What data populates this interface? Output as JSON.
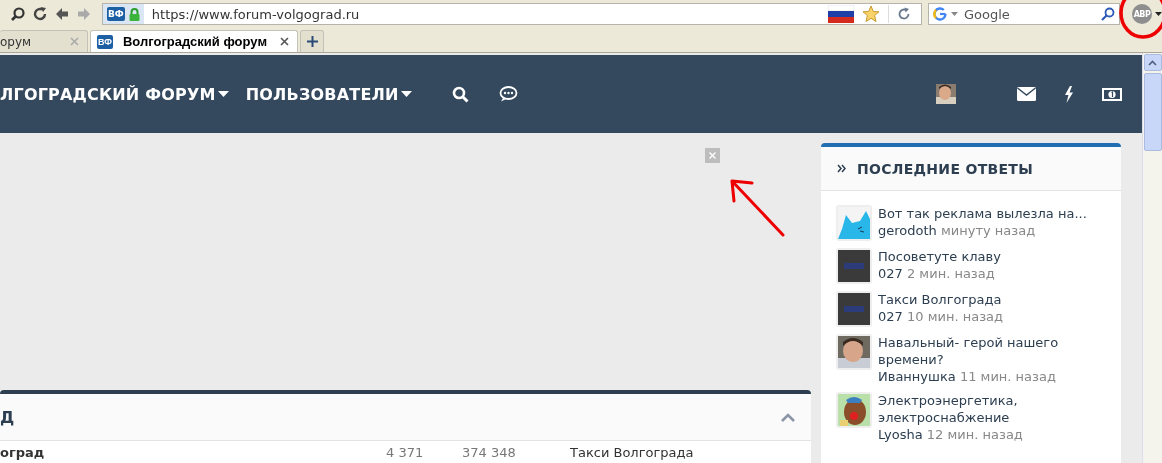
{
  "browser": {
    "address": "https://www.forum-volgograd.ru",
    "site_badge": "ВФ",
    "search": {
      "placeholder": "Google"
    },
    "abp_label": "ABP"
  },
  "tabs": [
    {
      "label": "орум",
      "selected": false
    },
    {
      "label": "Волгоградский форум",
      "badge": "ВФ",
      "selected": true
    }
  ],
  "nav": {
    "items": [
      {
        "label": "ЛГОГРАДСКИЙ ФОРУМ",
        "dropdown": true
      },
      {
        "label": "ПОЛЬЗОВАТЕЛИ",
        "dropdown": true
      }
    ]
  },
  "sidebar": {
    "title": "ПОСЛЕДНИЕ ОТВЕТЫ",
    "items": [
      {
        "title": "Вот так реклама вылезла на...",
        "author": "gerodoth",
        "time": "минуту назад"
      },
      {
        "title": "Посоветуте клаву",
        "author": "027",
        "time": "2 мин. назад"
      },
      {
        "title": "Такси Волгограда",
        "author": "027",
        "time": "10 мин. назад"
      },
      {
        "title": "Навальный- герой нашего времени?",
        "author": "Иваннушка",
        "time": "11 мин. назад"
      },
      {
        "title": "Электроэнергетика, электроснабжение",
        "author": "Lyosha",
        "time": "12 мин. назад"
      }
    ]
  },
  "forum": {
    "title": "Д",
    "rows": [
      {
        "name": "оград",
        "topics": "4 371",
        "posts": "374 348",
        "last": "Такси Волгограда"
      }
    ]
  }
}
